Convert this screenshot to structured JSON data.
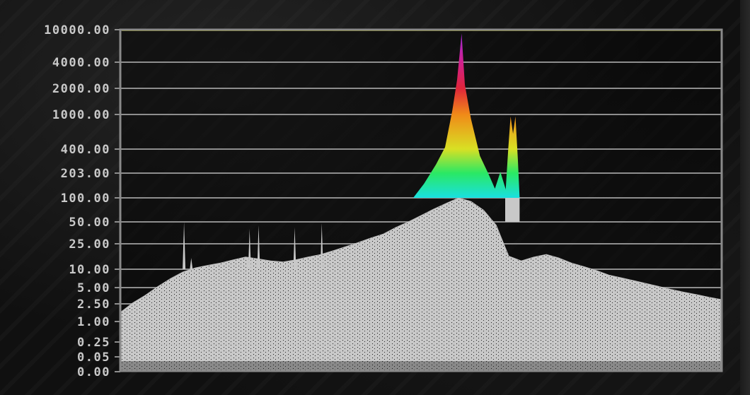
{
  "chart_data": {
    "type": "area",
    "title": "",
    "xlabel": "",
    "ylabel": "",
    "y_scale": "nonlinear-ticked",
    "grid": true,
    "ylim": [
      0,
      10000
    ],
    "y_ticks": [
      {
        "value": 10000,
        "label": "10000.00"
      },
      {
        "value": 4000,
        "label": "4000.00"
      },
      {
        "value": 2000,
        "label": "2000.00"
      },
      {
        "value": 1000,
        "label": "1000.00"
      },
      {
        "value": 400,
        "label": "400.00"
      },
      {
        "value": 203,
        "label": "203.00"
      },
      {
        "value": 100,
        "label": "100.00"
      },
      {
        "value": 50,
        "label": "50.00"
      },
      {
        "value": 25,
        "label": "25.00"
      },
      {
        "value": 10,
        "label": "10.00"
      },
      {
        "value": 5,
        "label": "5.00"
      },
      {
        "value": 2.5,
        "label": "2.50"
      },
      {
        "value": 1,
        "label": "1.00"
      },
      {
        "value": 0.25,
        "label": "0.25"
      },
      {
        "value": 0.05,
        "label": "0.05"
      },
      {
        "value": 0,
        "label": "0.00"
      }
    ],
    "reference_line": {
      "value": 10000,
      "color": "#e6e600"
    },
    "series": [
      {
        "values": [
          1.6,
          2.6,
          3.6,
          5.2,
          7.0,
          9.0,
          10.5,
          11.5,
          12.5,
          14.0,
          15.5,
          14.5,
          13.5,
          13.0,
          14.0,
          15.5,
          17.0,
          19.5,
          22.5,
          26.0,
          30.0,
          34.0,
          42.0,
          50.0,
          60.0,
          72.0,
          85.0,
          100.0,
          90.0,
          70.0,
          45.0,
          16.0,
          13.5,
          15.5,
          17.0,
          15.0,
          12.5,
          11.0,
          9.5,
          8.0,
          7.2,
          6.5,
          5.8,
          5.2,
          4.6,
          4.1,
          3.7,
          3.3,
          3.0
        ],
        "fill_color": "#c8c8c8",
        "spikes": [
          {
            "x_frac": 0.106,
            "value": 50
          },
          {
            "x_frac": 0.118,
            "value": 15
          },
          {
            "x_frac": 0.215,
            "value": 40
          },
          {
            "x_frac": 0.23,
            "value": 45
          },
          {
            "x_frac": 0.29,
            "value": 42
          },
          {
            "x_frac": 0.335,
            "value": 48
          }
        ]
      },
      {
        "values_above_clip": [
          {
            "x_frac": 0.487,
            "value": 100
          },
          {
            "x_frac": 0.505,
            "value": 150
          },
          {
            "x_frac": 0.525,
            "value": 260
          },
          {
            "x_frac": 0.54,
            "value": 420
          },
          {
            "x_frac": 0.552,
            "value": 1100
          },
          {
            "x_frac": 0.56,
            "value": 2500
          },
          {
            "x_frac": 0.5675,
            "value": 9000
          },
          {
            "x_frac": 0.573,
            "value": 2200
          },
          {
            "x_frac": 0.583,
            "value": 900
          },
          {
            "x_frac": 0.598,
            "value": 330
          },
          {
            "x_frac": 0.612,
            "value": 200
          },
          {
            "x_frac": 0.623,
            "value": 130
          },
          {
            "x_frac": 0.632,
            "value": 210
          },
          {
            "x_frac": 0.642,
            "value": 120
          },
          {
            "x_frac": 0.65,
            "value": 100
          }
        ],
        "second_peak": [
          {
            "x_frac": 0.64,
            "value": 100
          },
          {
            "x_frac": 0.645,
            "value": 400
          },
          {
            "x_frac": 0.649,
            "value": 950
          },
          {
            "x_frac": 0.653,
            "value": 600
          },
          {
            "x_frac": 0.657,
            "value": 950
          },
          {
            "x_frac": 0.661,
            "value": 300
          },
          {
            "x_frac": 0.664,
            "value": 100
          }
        ],
        "gradient": [
          {
            "value": 100,
            "color": "#19e0e0"
          },
          {
            "value": 203,
            "color": "#2ae864"
          },
          {
            "value": 400,
            "color": "#d8e024"
          },
          {
            "value": 1000,
            "color": "#f08a18"
          },
          {
            "value": 2000,
            "color": "#e0253a"
          },
          {
            "value": 4000,
            "color": "#d0208e"
          },
          {
            "value": 10000,
            "color": "#9a2ce0"
          }
        ]
      }
    ],
    "colors": {
      "grid": "#8e8e8e",
      "frame": "#8a8a8a",
      "tick_label": "#c9c9c9",
      "plot_bg": "#0a0a0a"
    }
  }
}
